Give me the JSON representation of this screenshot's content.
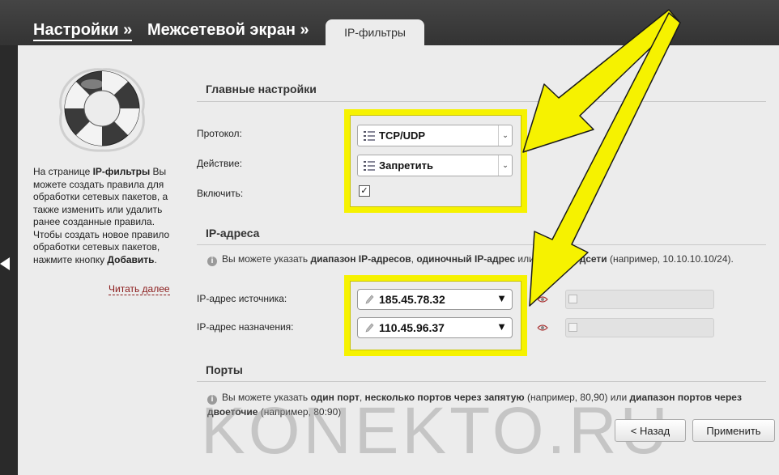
{
  "breadcrumb": {
    "item1": "Настройки »",
    "item2": "Межсетевой экран »",
    "active_tab": "IP-фильтры"
  },
  "sidebar": {
    "help_text_parts": [
      "На странице ",
      "IP-фильтры",
      " Вы можете создать правила для обработки сетевых пакетов, а также изменить или удалить ранее созданные правила. Чтобы создать новое правило обработки сетевых пакетов, нажмите кнопку ",
      "Добавить",
      "."
    ],
    "read_more": "Читать далее"
  },
  "main_settings": {
    "title": "Главные настройки",
    "protocol_label": "Протокол:",
    "protocol_value": "TCP/UDP",
    "action_label": "Действие:",
    "action_value": "Запретить",
    "enable_label": "Включить:",
    "enable_checked": true,
    "enable_mark": "✓"
  },
  "ip_addresses": {
    "title": "IP-адреса",
    "info_parts": [
      "Вы можете указать ",
      "диапазон IP-адресов",
      ", ",
      "одиночный IP-адрес",
      " или ",
      "адрес подсети",
      " (например, 10.10.10.10/24)."
    ],
    "source_label": "IP-адрес источника:",
    "source_value": "185.45.78.32",
    "dest_label": "IP-адрес назначения:",
    "dest_value": "110.45.96.37"
  },
  "ports": {
    "title": "Порты",
    "info_parts": [
      "Вы можете указать ",
      "один порт",
      ", ",
      "несколько портов через запятую",
      " (например, 80,90) или ",
      "диапазон портов через двоеточие",
      " (например, 80:90)"
    ]
  },
  "buttons": {
    "back": "< Назад",
    "apply": "Применить"
  },
  "watermark": "KONEKTO.RU",
  "colors": {
    "highlight": "#f6f200",
    "panel_bg": "#ececec",
    "topbar_bg": "#3a3a3a"
  }
}
